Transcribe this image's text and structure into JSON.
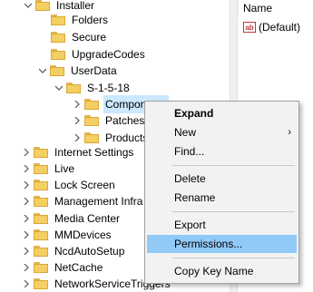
{
  "tree": {
    "rows": [
      {
        "label": "Installer",
        "expanded": true,
        "depth": 2
      },
      {
        "label": "Folders",
        "depth": 3
      },
      {
        "label": "Secure",
        "depth": 3
      },
      {
        "label": "UpgradeCodes",
        "depth": 3
      },
      {
        "label": "UserData",
        "expanded": true,
        "depth": 3
      },
      {
        "label": "S-1-5-18",
        "expanded": true,
        "depth": 4
      },
      {
        "label": "Components",
        "depth": 5,
        "selected": true
      },
      {
        "label": "Patches",
        "depth": 5
      },
      {
        "label": "Products",
        "depth": 5
      },
      {
        "label": "Internet Settings",
        "depth": 1
      },
      {
        "label": "Live",
        "depth": 1
      },
      {
        "label": "Lock Screen",
        "depth": 1
      },
      {
        "label": "Management Infra",
        "depth": 1
      },
      {
        "label": "Media Center",
        "depth": 1
      },
      {
        "label": "MMDevices",
        "depth": 1
      },
      {
        "label": "NcdAutoSetup",
        "depth": 1
      },
      {
        "label": "NetCache",
        "depth": 1
      },
      {
        "label": "NetworkServiceTriggers",
        "depth": 1
      }
    ]
  },
  "values_pane": {
    "column_name": "Name",
    "default_value": "(Default)",
    "default_icon_text": "ab"
  },
  "context_menu": {
    "items": [
      {
        "label": "Expand",
        "bold": true
      },
      {
        "label": "New",
        "submenu": true
      },
      {
        "label": "Find..."
      },
      {
        "label": "Delete"
      },
      {
        "label": "Rename"
      },
      {
        "label": "Export"
      },
      {
        "label": "Permissions...",
        "highlighted": true
      },
      {
        "label": "Copy Key Name"
      }
    ],
    "submenu_arrow": "›"
  }
}
